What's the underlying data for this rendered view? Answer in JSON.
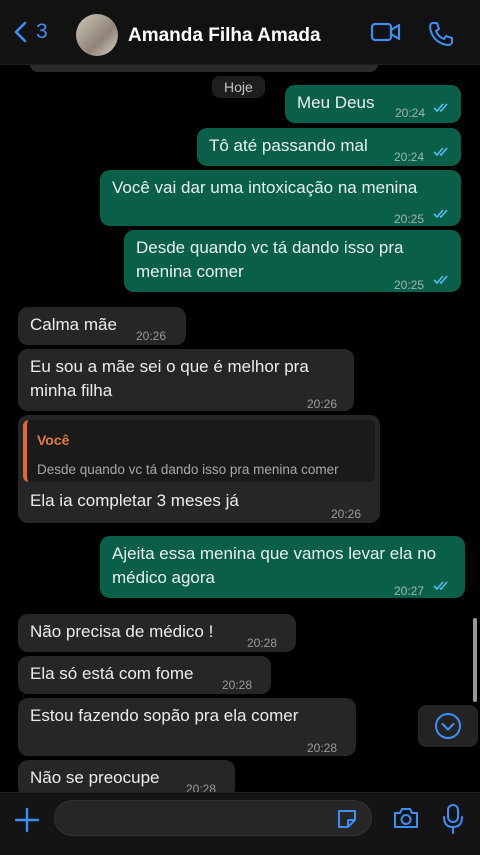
{
  "header": {
    "back_count": "3",
    "contact_name": "Amanda Filha Amada",
    "icons": {
      "back": "chevron-left-icon",
      "video": "video-camera-icon",
      "call": "phone-icon"
    },
    "accent": "#3b8ff5"
  },
  "chat": {
    "day_label": "Hoje",
    "messages": [
      {
        "dir": "out",
        "text": "Meu Deus",
        "time": "20:24",
        "status": "read"
      },
      {
        "dir": "out",
        "text": "Tô até passando mal",
        "time": "20:24",
        "status": "read"
      },
      {
        "dir": "out",
        "text": "Você vai dar uma intoxicação na menina",
        "time": "20:25",
        "status": "read"
      },
      {
        "dir": "out",
        "text": "Desde quando vc tá dando isso pra menina comer",
        "time": "20:25",
        "status": "read"
      },
      {
        "dir": "in",
        "text": "Calma mãe",
        "time": "20:26"
      },
      {
        "dir": "in",
        "text": "Eu sou a mãe sei o que é melhor pra minha filha",
        "time": "20:26"
      },
      {
        "dir": "in",
        "text": "Ela ia completar 3 meses já",
        "time": "20:26",
        "quote": {
          "author": "Você",
          "text": "Desde quando vc tá dando isso pra menina comer"
        }
      },
      {
        "dir": "out",
        "text": "Ajeita essa menina que vamos levar ela no médico agora",
        "time": "20:27",
        "status": "read"
      },
      {
        "dir": "in",
        "text": "Não precisa de médico !",
        "time": "20:28"
      },
      {
        "dir": "in",
        "text": "Ela só está com fome",
        "time": "20:28"
      },
      {
        "dir": "in",
        "text": "Estou fazendo sopão pra ela comer",
        "time": "20:28"
      },
      {
        "dir": "in",
        "text": "Não se preocupe",
        "time": "20:28"
      }
    ],
    "colors": {
      "outgoing": "#0a5f48",
      "incoming": "#262626",
      "quote_accent": "#e06a2a",
      "read_ticks": "#53bdeb"
    }
  },
  "composer": {
    "placeholder": "",
    "icons": {
      "attach": "plus-icon",
      "sticker": "sticker-icon",
      "camera": "camera-icon",
      "mic": "microphone-icon"
    }
  }
}
